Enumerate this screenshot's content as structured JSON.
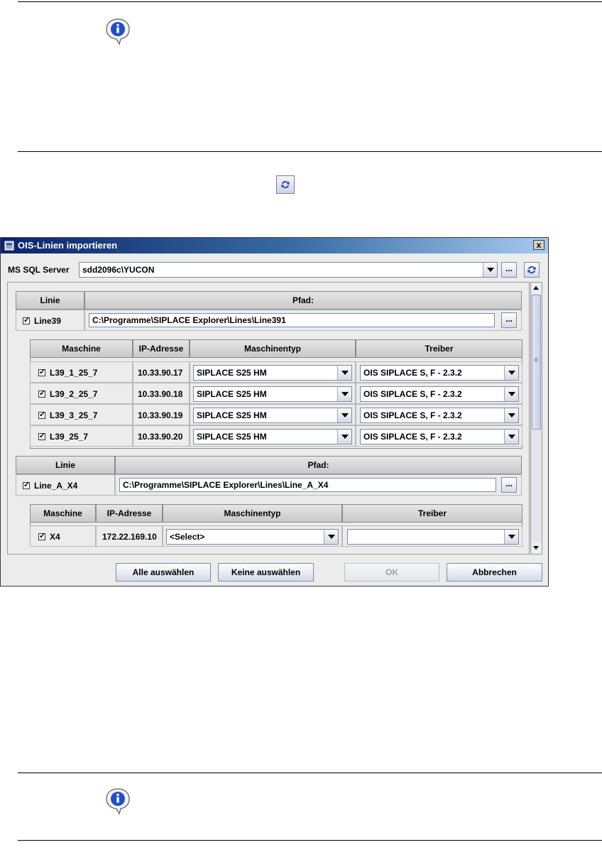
{
  "dialog": {
    "title": "OIS-Linien importieren",
    "close_label": "x",
    "server_label": "MS SQL Server",
    "server_value": "sdd2096c\\YUCON",
    "browse_label": "..."
  },
  "columns": {
    "line": "Linie",
    "path": "Pfad:",
    "machine": "Maschine",
    "ip": "IP-Adresse",
    "type": "Maschinentyp",
    "driver": "Treiber"
  },
  "lines": [
    {
      "name": "Line39",
      "checked": true,
      "path": "C:\\Programme\\SIPLACE Explorer\\Lines\\Line391",
      "machines": [
        {
          "name": "L39_1_25_7",
          "ip": "10.33.90.17",
          "type": "SIPLACE S25 HM",
          "driver": "OIS SIPLACE S, F - 2.3.2"
        },
        {
          "name": "L39_2_25_7",
          "ip": "10.33.90.18",
          "type": "SIPLACE S25 HM",
          "driver": "OIS SIPLACE S, F - 2.3.2"
        },
        {
          "name": "L39_3_25_7",
          "ip": "10.33.90.19",
          "type": "SIPLACE S25 HM",
          "driver": "OIS SIPLACE S, F - 2.3.2"
        },
        {
          "name": "L39_25_7",
          "ip": "10.33.90.20",
          "type": "SIPLACE S25 HM",
          "driver": "OIS SIPLACE S, F - 2.3.2"
        }
      ]
    },
    {
      "name": "Line_A_X4",
      "checked": true,
      "path": "C:\\Programme\\SIPLACE Explorer\\Lines\\Line_A_X4",
      "machines": [
        {
          "name": "X4",
          "ip": "172.22.169.10",
          "type": "<Select>",
          "driver": ""
        }
      ]
    }
  ],
  "buttons": {
    "select_all": "Alle auswählen",
    "select_none": "Keine auswählen",
    "ok": "OK",
    "cancel": "Abbrechen"
  },
  "icons": {
    "info": "info-icon",
    "refresh": "refresh-icon"
  }
}
